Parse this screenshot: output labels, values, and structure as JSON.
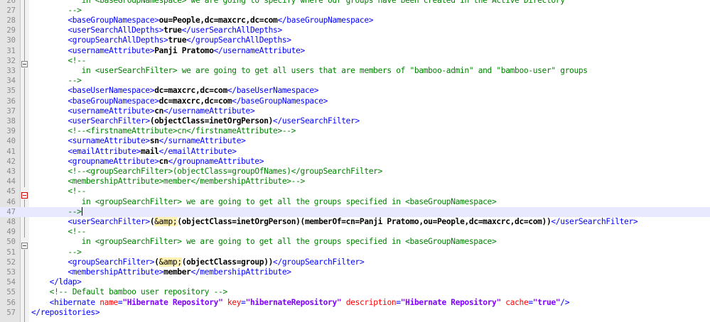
{
  "editor": {
    "current_line": "47",
    "lines": [
      {
        "n": "26",
        "t": [
          {
            "k": "c",
            "s": "           in <baseGroupNamespace> we are going to specify where our groups have been created in the Active Directory"
          }
        ]
      },
      {
        "n": "27",
        "t": [
          {
            "k": "c",
            "s": "        -->"
          }
        ]
      },
      {
        "n": "28",
        "t": [
          {
            "k": "i",
            "s": "        "
          },
          {
            "k": "t",
            "s": "<baseGroupNamespace>"
          },
          {
            "k": "v",
            "s": "ou=People,dc=maxcrc,dc=com"
          },
          {
            "k": "t",
            "s": "</baseGroupNamespace>"
          }
        ]
      },
      {
        "n": "29",
        "t": [
          {
            "k": "i",
            "s": "        "
          },
          {
            "k": "t",
            "s": "<userSearchAllDepths>"
          },
          {
            "k": "v",
            "s": "true"
          },
          {
            "k": "t",
            "s": "</userSearchAllDepths>"
          }
        ]
      },
      {
        "n": "30",
        "t": [
          {
            "k": "i",
            "s": "        "
          },
          {
            "k": "t",
            "s": "<groupSearchAllDepths>"
          },
          {
            "k": "v",
            "s": "true"
          },
          {
            "k": "t",
            "s": "</groupSearchAllDepths>"
          }
        ]
      },
      {
        "n": "31",
        "t": [
          {
            "k": "i",
            "s": "        "
          },
          {
            "k": "t",
            "s": "<usernameAttribute>"
          },
          {
            "k": "v",
            "s": "Panji Pratomo"
          },
          {
            "k": "t",
            "s": "</usernameAttribute>"
          }
        ]
      },
      {
        "n": "32",
        "t": [
          {
            "k": "c",
            "s": "        <!--"
          }
        ]
      },
      {
        "n": "33",
        "t": [
          {
            "k": "c",
            "s": "           in <userSearchFilter> we are going to get all users that are members of \"bamboo-admin\" and \"bamboo-user\" groups"
          }
        ]
      },
      {
        "n": "34",
        "t": [
          {
            "k": "c",
            "s": "        -->"
          }
        ]
      },
      {
        "n": "35",
        "t": [
          {
            "k": "i",
            "s": "        "
          },
          {
            "k": "t",
            "s": "<baseUserNamespace>"
          },
          {
            "k": "v",
            "s": "dc=maxcrc,dc=com"
          },
          {
            "k": "t",
            "s": "</baseUserNamespace>"
          }
        ]
      },
      {
        "n": "36",
        "t": [
          {
            "k": "i",
            "s": "        "
          },
          {
            "k": "t",
            "s": "<baseGroupNamespace>"
          },
          {
            "k": "v",
            "s": "dc=maxcrc,dc=com"
          },
          {
            "k": "t",
            "s": "</baseGroupNamespace>"
          }
        ]
      },
      {
        "n": "37",
        "t": [
          {
            "k": "i",
            "s": "        "
          },
          {
            "k": "t",
            "s": "<usernameAttribute>"
          },
          {
            "k": "v",
            "s": "cn"
          },
          {
            "k": "t",
            "s": "</usernameAttribute>"
          }
        ]
      },
      {
        "n": "38",
        "t": [
          {
            "k": "i",
            "s": "        "
          },
          {
            "k": "t",
            "s": "<userSearchFilter>"
          },
          {
            "k": "v",
            "s": "(objectClass=inetOrgPerson)"
          },
          {
            "k": "t",
            "s": "</userSearchFilter>"
          }
        ]
      },
      {
        "n": "39",
        "t": [
          {
            "k": "i",
            "s": "        "
          },
          {
            "k": "c",
            "s": "<!--<firstnameAttribute>cn</firstnameAttribute>-->"
          }
        ]
      },
      {
        "n": "40",
        "t": [
          {
            "k": "i",
            "s": "        "
          },
          {
            "k": "t",
            "s": "<surnameAttribute>"
          },
          {
            "k": "v",
            "s": "sn"
          },
          {
            "k": "t",
            "s": "</surnameAttribute>"
          }
        ]
      },
      {
        "n": "41",
        "t": [
          {
            "k": "i",
            "s": "        "
          },
          {
            "k": "t",
            "s": "<emailAttribute>"
          },
          {
            "k": "v",
            "s": "mail"
          },
          {
            "k": "t",
            "s": "</emailAttribute>"
          }
        ]
      },
      {
        "n": "42",
        "t": [
          {
            "k": "i",
            "s": "        "
          },
          {
            "k": "t",
            "s": "<groupnameAttribute>"
          },
          {
            "k": "v",
            "s": "cn"
          },
          {
            "k": "t",
            "s": "</groupnameAttribute>"
          }
        ]
      },
      {
        "n": "43",
        "t": [
          {
            "k": "i",
            "s": "        "
          },
          {
            "k": "c",
            "s": "<!--<groupSearchFilter>(objectClass=groupOfNames)</groupSearchFilter>"
          }
        ]
      },
      {
        "n": "44",
        "t": [
          {
            "k": "c",
            "s": "        <membershipAttribute>member</membershipAttribute>-->"
          }
        ]
      },
      {
        "n": "45",
        "t": [
          {
            "k": "c",
            "s": "        <!--"
          }
        ]
      },
      {
        "n": "46",
        "t": [
          {
            "k": "c",
            "s": "           in <groupSearchFilter> we are going to get all the groups specified in <baseGroupNamespace>"
          }
        ]
      },
      {
        "n": "47",
        "t": [
          {
            "k": "c",
            "s": "        -->"
          }
        ]
      },
      {
        "n": "48",
        "t": [
          {
            "k": "i",
            "s": "        "
          },
          {
            "k": "t",
            "s": "<userSearchFilter>"
          },
          {
            "k": "v",
            "s": "("
          },
          {
            "k": "e",
            "s": "&amp;"
          },
          {
            "k": "v",
            "s": "(objectClass=inetOrgPerson)(memberOf=cn=Panji Pratomo,ou=People,dc=maxcrc,dc=com))"
          },
          {
            "k": "t",
            "s": "</userSearchFilter>"
          }
        ]
      },
      {
        "n": "49",
        "t": [
          {
            "k": "c",
            "s": "        <!--"
          }
        ]
      },
      {
        "n": "50",
        "t": [
          {
            "k": "c",
            "s": "           in <groupSearchFilter> we are going to get all the groups specified in <baseGroupNamespace>"
          }
        ]
      },
      {
        "n": "51",
        "t": [
          {
            "k": "c",
            "s": "        -->"
          }
        ]
      },
      {
        "n": "52",
        "t": [
          {
            "k": "i",
            "s": "        "
          },
          {
            "k": "t",
            "s": "<groupSearchFilter>"
          },
          {
            "k": "v",
            "s": "("
          },
          {
            "k": "e",
            "s": "&amp;"
          },
          {
            "k": "v",
            "s": "(objectClass=group))"
          },
          {
            "k": "t",
            "s": "</groupSearchFilter>"
          }
        ]
      },
      {
        "n": "53",
        "t": [
          {
            "k": "i",
            "s": "        "
          },
          {
            "k": "t",
            "s": "<membershipAttribute>"
          },
          {
            "k": "v",
            "s": "member"
          },
          {
            "k": "t",
            "s": "</membershipAttribute>"
          }
        ]
      },
      {
        "n": "54",
        "t": [
          {
            "k": "i",
            "s": "    "
          },
          {
            "k": "t",
            "s": "</ldap>"
          }
        ]
      },
      {
        "n": "55",
        "t": [
          {
            "k": "i",
            "s": "    "
          },
          {
            "k": "c",
            "s": "<!-- Default bamboo user repository -->"
          }
        ]
      },
      {
        "n": "56",
        "t": [
          {
            "k": "i",
            "s": "    "
          },
          {
            "k": "t",
            "s": "<hibernate "
          },
          {
            "k": "a",
            "s": "name"
          },
          {
            "k": "t",
            "s": "="
          },
          {
            "k": "q",
            "s": "\"Hibernate Repository\""
          },
          {
            "k": "t",
            "s": " "
          },
          {
            "k": "a",
            "s": "key"
          },
          {
            "k": "t",
            "s": "="
          },
          {
            "k": "q",
            "s": "\"hibernateRepository\""
          },
          {
            "k": "t",
            "s": " "
          },
          {
            "k": "a",
            "s": "description"
          },
          {
            "k": "t",
            "s": "="
          },
          {
            "k": "q",
            "s": "\"Hibernate Repository\""
          },
          {
            "k": "t",
            "s": " "
          },
          {
            "k": "a",
            "s": "cache"
          },
          {
            "k": "t",
            "s": "="
          },
          {
            "k": "q",
            "s": "\"true\""
          },
          {
            "k": "t",
            "s": "/>"
          }
        ]
      },
      {
        "n": "57",
        "t": [
          {
            "k": "t",
            "s": "</repositories>"
          }
        ]
      }
    ]
  },
  "colors": {
    "tag": "#0000ff",
    "value": "#000000",
    "comment": "#008000",
    "entity": "#000000",
    "attribute": "#ff0000",
    "attribute_value": "#8000ff",
    "current_line_bg": "#e8e8ff",
    "gutter_bg": "#e4e4e4"
  },
  "icons": {
    "fold_marker": "fold-minus-icon"
  }
}
